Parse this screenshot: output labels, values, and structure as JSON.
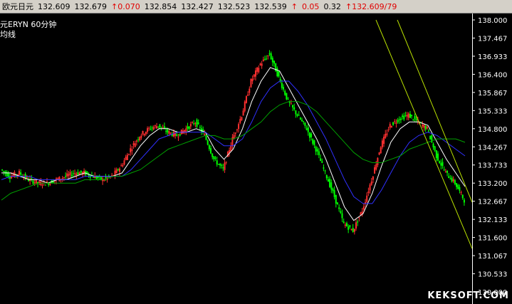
{
  "toolbar": {
    "symbol": "欧元日元",
    "open": "132.609",
    "high_price": "132.679",
    "change": "↑0.070",
    "p1": "132.854",
    "p2": "132.427",
    "p3": "132.523",
    "p4": "132.539",
    "change2": "↑",
    "v1": "0.05",
    "v2": "0.32",
    "change3": "↑132.609/79"
  },
  "overlay": {
    "line1": "元ERYN   60分钟",
    "line2": "均线"
  },
  "watermark": "KEKSOFT.COM",
  "colors": {
    "background": "#000000",
    "up_candle": "#ff3030",
    "down_candle": "#00ff00",
    "ma_white": "#ffffff",
    "ma_blue": "#3030ff",
    "ma_green": "#00a000",
    "channel": "#b8e000",
    "axis": "#ffffff"
  },
  "chart_data": {
    "type": "line",
    "price_axis_labels": [
      "138.000",
      "137.467",
      "136.933",
      "136.400",
      "135.867",
      "135.333",
      "134.800",
      "134.267",
      "133.733",
      "133.200",
      "132.667",
      "132.133",
      "131.600",
      "131.067",
      "130.533",
      "130.000"
    ],
    "ylim": [
      130.0,
      138.0
    ],
    "series": [
      {
        "values": [
          133.6,
          133.4,
          133.5,
          133.3,
          133.2,
          133.2,
          133.3,
          133.4,
          133.5,
          133.5,
          133.4,
          133.3,
          133.4,
          133.7,
          134.2,
          134.6,
          134.8,
          134.9,
          134.7,
          134.6,
          134.8,
          135.0,
          134.6,
          133.9,
          133.6,
          134.5,
          135.2,
          136.2,
          136.7,
          137.0,
          136.3,
          135.6,
          135.2,
          134.8,
          134.2,
          133.5,
          132.8,
          132.0,
          131.8,
          132.4,
          133.3,
          134.3,
          134.9,
          135.1,
          135.2,
          135.0,
          134.8,
          134.0,
          133.5,
          133.2,
          132.7
        ]
      },
      {
        "name": "",
        "values": [
          133.5,
          133.5,
          133.4,
          133.3,
          133.3,
          133.2,
          133.3,
          133.3,
          133.4,
          133.5,
          133.4,
          133.4,
          133.4,
          133.5,
          133.9,
          134.3,
          134.6,
          134.8,
          134.8,
          134.7,
          134.7,
          134.8,
          134.7,
          134.2,
          133.9,
          134.2,
          134.8,
          135.6,
          136.2,
          136.6,
          136.5,
          136.0,
          135.5,
          135.0,
          134.5,
          133.9,
          133.2,
          132.5,
          132.1,
          132.3,
          132.9,
          133.7,
          134.4,
          134.8,
          135.0,
          135.0,
          134.9,
          134.4,
          133.9,
          133.5,
          133.1
        ]
      },
      {
        "name": "",
        "values": [
          133.3,
          133.4,
          133.4,
          133.4,
          133.3,
          133.3,
          133.3,
          133.3,
          133.3,
          133.4,
          133.4,
          133.4,
          133.4,
          133.4,
          133.6,
          133.9,
          134.2,
          134.5,
          134.6,
          134.7,
          134.7,
          134.7,
          134.7,
          134.5,
          134.3,
          134.3,
          134.5,
          135.0,
          135.6,
          136.0,
          136.2,
          136.2,
          135.9,
          135.5,
          135.0,
          134.5,
          133.9,
          133.3,
          132.8,
          132.6,
          132.6,
          133.0,
          133.5,
          134.0,
          134.4,
          134.6,
          134.7,
          134.6,
          134.4,
          134.2,
          134.0
        ]
      },
      {
        "name": "",
        "values": [
          132.7,
          132.9,
          133.0,
          133.1,
          133.2,
          133.2,
          133.2,
          133.2,
          133.2,
          133.3,
          133.3,
          133.3,
          133.4,
          133.4,
          133.5,
          133.6,
          133.8,
          134.0,
          134.2,
          134.3,
          134.4,
          134.5,
          134.6,
          134.6,
          134.5,
          134.5,
          134.6,
          134.8,
          135.0,
          135.3,
          135.5,
          135.6,
          135.6,
          135.5,
          135.3,
          135.0,
          134.7,
          134.4,
          134.1,
          133.9,
          133.8,
          133.8,
          133.9,
          134.0,
          134.2,
          134.3,
          134.4,
          134.5,
          134.5,
          134.5,
          134.4
        ]
      }
    ]
  }
}
